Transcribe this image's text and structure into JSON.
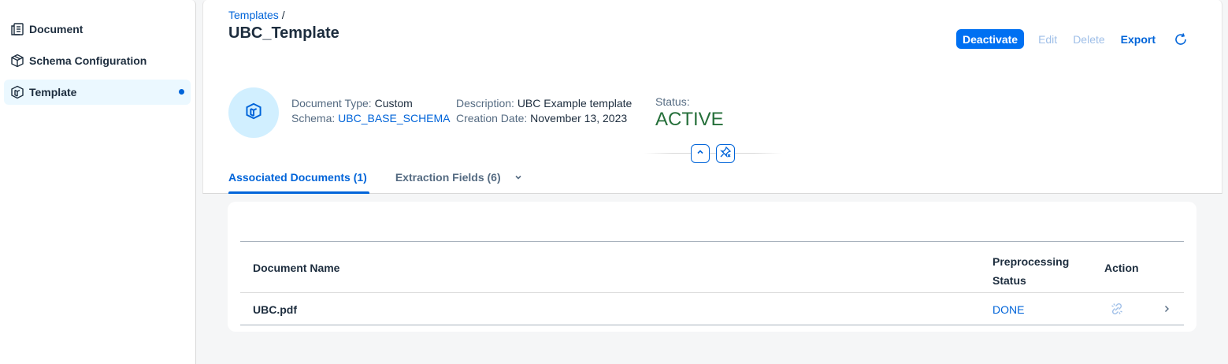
{
  "sidebar": {
    "items": [
      {
        "label": "Document",
        "icon": "document-icon",
        "active": false
      },
      {
        "label": "Schema Configuration",
        "icon": "cube-icon",
        "active": false
      },
      {
        "label": "Template",
        "icon": "template-icon",
        "active": true
      }
    ]
  },
  "header": {
    "breadcrumb": {
      "link": "Templates",
      "separator": "/"
    },
    "title": "UBC_Template",
    "actions": {
      "deactivate": "Deactivate",
      "edit": "Edit",
      "delete": "Delete",
      "export": "Export",
      "refresh_icon": "refresh-icon"
    },
    "attributes": {
      "document_type_label": "Document Type:",
      "document_type_value": "Custom",
      "schema_label": "Schema:",
      "schema_value": "UBC_BASE_SCHEMA",
      "description_label": "Description:",
      "description_value": "UBC Example template",
      "creation_date_label": "Creation Date:",
      "creation_date_value": "November 13, 2023",
      "status_label": "Status:",
      "status_value": "ACTIVE"
    }
  },
  "tabs": [
    {
      "label": "Associated Documents (1)",
      "active": true
    },
    {
      "label": "Extraction Fields (6)",
      "active": false
    }
  ],
  "table": {
    "columns": {
      "name": "Document Name",
      "status_line1": "Preprocessing",
      "status_line2": "Status",
      "action": "Action"
    },
    "rows": [
      {
        "name": "UBC.pdf",
        "status": "DONE"
      }
    ]
  },
  "colors": {
    "accent": "#0064d9",
    "primary_button": "#0070f2",
    "status_active": "#256f3a",
    "active_nav_bg": "#ebf8ff"
  }
}
